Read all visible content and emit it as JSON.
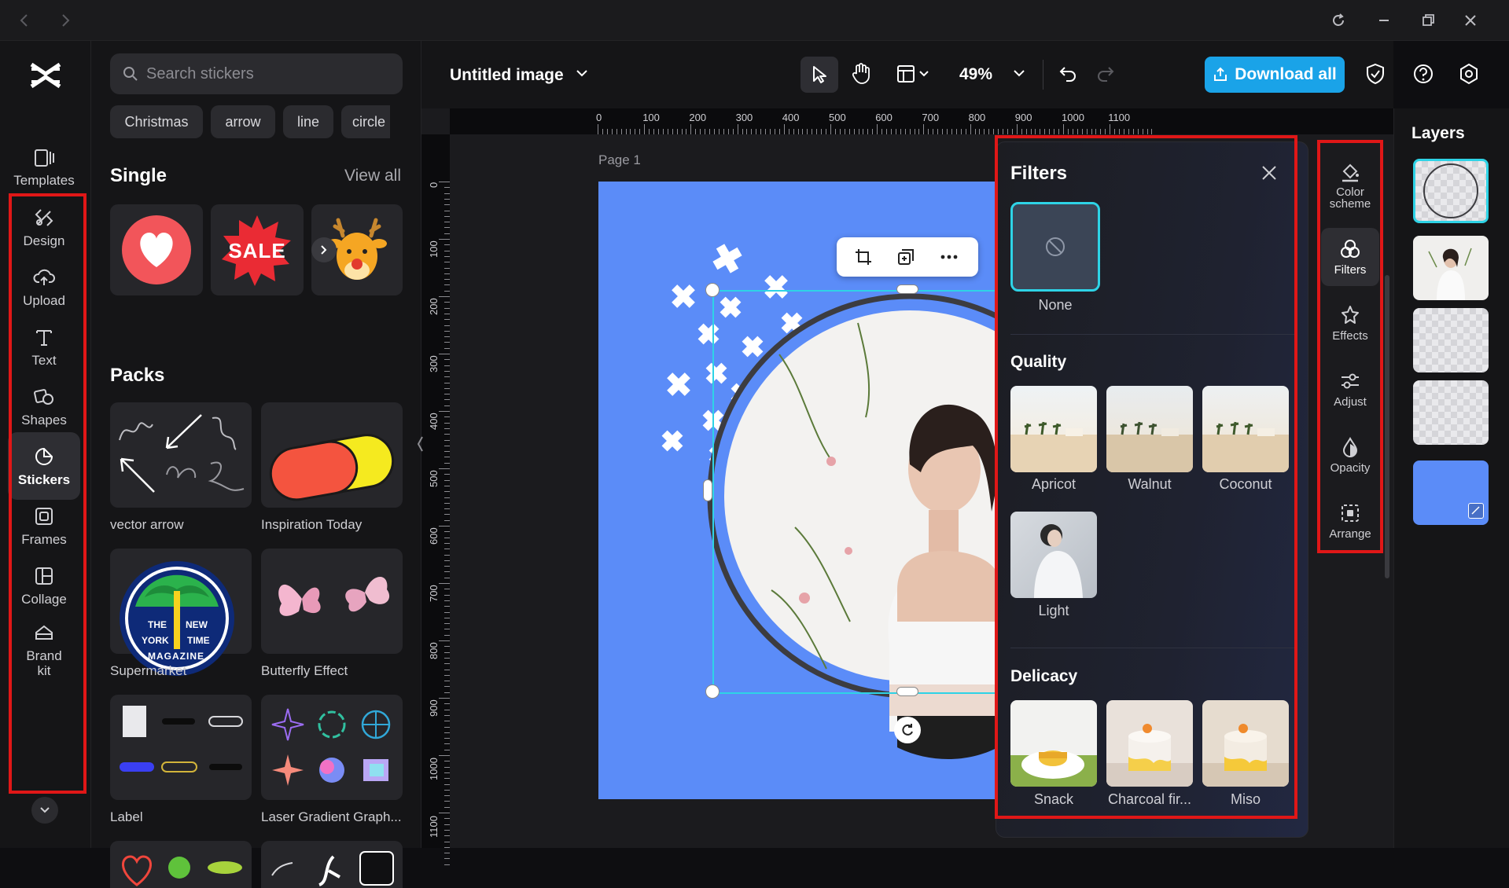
{
  "titlebar": {
    "back": "back-icon",
    "forward": "forward-icon",
    "refresh": "refresh-icon",
    "minimize": "minimize-icon",
    "restore": "restore-icon",
    "close": "close-icon"
  },
  "leftnav": {
    "items": [
      {
        "label": "Templates",
        "icon": "templates-icon"
      },
      {
        "label": "Design",
        "icon": "design-icon"
      },
      {
        "label": "Upload",
        "icon": "upload-icon"
      },
      {
        "label": "Text",
        "icon": "text-icon"
      },
      {
        "label": "Shapes",
        "icon": "shapes-icon"
      },
      {
        "label": "Stickers",
        "icon": "stickers-icon",
        "active": true
      },
      {
        "label": "Frames",
        "icon": "frames-icon"
      },
      {
        "label": "Collage",
        "icon": "collage-icon"
      },
      {
        "label": "Brand kit",
        "icon": "brand-kit-icon"
      }
    ]
  },
  "stickers": {
    "search_placeholder": "Search stickers",
    "chips": [
      "Christmas",
      "arrow",
      "line",
      "circle"
    ],
    "single_title": "Single",
    "view_all": "View all",
    "single_items": [
      "heart-sticker",
      "sale-sticker",
      "reindeer-sticker"
    ],
    "sale_text": "SALE",
    "packs_title": "Packs",
    "packs": [
      "vector arrow",
      "Inspiration Today",
      "Supermarket",
      "Butterfly Effect",
      "Label",
      "Laser Gradient Graph..."
    ],
    "badge_lines": [
      "THE",
      "NEW",
      "YORK",
      "TIME",
      "MAGAZINE"
    ]
  },
  "toolbar": {
    "doc_title": "Untitled image",
    "zoom": "49%",
    "download_label": "Download all"
  },
  "ruler": {
    "h_ticks": [
      "0",
      "100",
      "200",
      "300",
      "400",
      "500",
      "600",
      "700",
      "800",
      "900",
      "1000",
      "1100"
    ],
    "v_ticks": [
      "0",
      "100",
      "200",
      "300",
      "400",
      "500",
      "600",
      "700",
      "800",
      "900",
      "1000",
      "1100"
    ]
  },
  "canvas": {
    "page_label": "Page 1",
    "bg_color": "#5b8cf8"
  },
  "filters": {
    "title": "Filters",
    "none_label": "None",
    "quality_title": "Quality",
    "quality": [
      "Apricot",
      "Walnut",
      "Coconut",
      "Light"
    ],
    "delicacy_title": "Delicacy",
    "delicacy": [
      "Snack",
      "Charcoal fir...",
      "Miso"
    ]
  },
  "tools": [
    {
      "label": "Color scheme",
      "icon": "color-scheme-icon"
    },
    {
      "label": "Filters",
      "icon": "filters-icon",
      "active": true
    },
    {
      "label": "Effects",
      "icon": "effects-icon"
    },
    {
      "label": "Adjust",
      "icon": "adjust-icon"
    },
    {
      "label": "Opacity",
      "icon": "opacity-icon"
    },
    {
      "label": "Arrange",
      "icon": "arrange-icon"
    }
  ],
  "layers": {
    "title": "Layers"
  },
  "colors": {
    "accent": "#1aa3e8",
    "highlight": "#e01717",
    "selection": "#2ed3e6"
  }
}
